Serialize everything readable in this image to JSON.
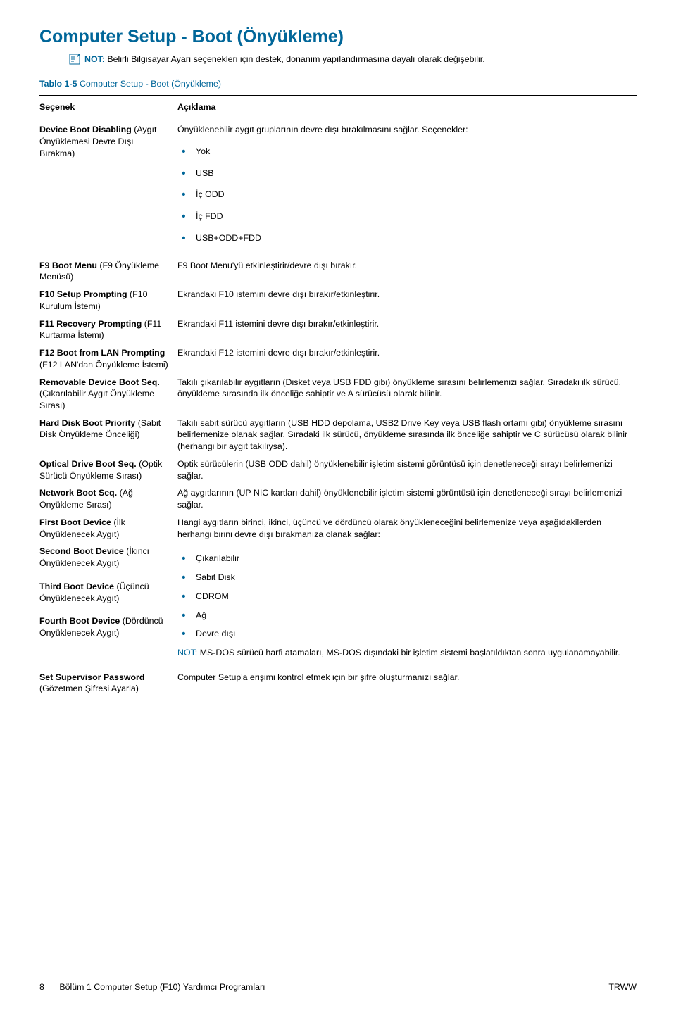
{
  "title": "Computer Setup - Boot (Önyükleme)",
  "note": {
    "label": "NOT:",
    "text": "Belirli Bilgisayar Ayarı seçenekleri için destek, donanım yapılandırmasına dayalı olarak değişebilir."
  },
  "caption": {
    "lbl": "Tablo 1-5",
    "txt": "Computer Setup - Boot (Önyükleme)"
  },
  "head": {
    "c1": "Seçenek",
    "c2": "Açıklama"
  },
  "rows": {
    "deviceBootDisabling": {
      "name_b": "Device Boot Disabling",
      "name_r": " (Aygıt Önyüklemesi Devre Dışı Bırakma)",
      "desc_lead": "Önyüklenebilir aygıt gruplarının devre dışı bırakılmasını sağlar. Seçenekler:",
      "opts": [
        "Yok",
        "USB",
        "İç ODD",
        "İç FDD",
        "USB+ODD+FDD"
      ]
    },
    "f9": {
      "name_b": "F9 Boot Menu",
      "name_r": " (F9 Önyükleme Menüsü)",
      "desc": "F9 Boot Menu'yü etkinleştirir/devre dışı bırakır."
    },
    "f10": {
      "name_b": "F10 Setup Prompting",
      "name_r": " (F10 Kurulum İstemi)",
      "desc": "Ekrandaki F10 istemini devre dışı bırakır/etkinleştirir."
    },
    "f11": {
      "name_b": "F11 Recovery Prompting",
      "name_r": " (F11 Kurtarma İstemi)",
      "desc": "Ekrandaki F11 istemini devre dışı bırakır/etkinleştirir."
    },
    "f12": {
      "name_b": "F12 Boot from LAN Prompting",
      "name_r": " (F12 LAN'dan Önyükleme İstemi)",
      "desc": "Ekrandaki F12 istemini devre dışı bırakır/etkinleştirir."
    },
    "removable": {
      "name_b": "Removable Device Boot Seq.",
      "name_r": " (Çıkarılabilir Aygıt Önyükleme Sırası)",
      "desc": "Takılı çıkarılabilir aygıtların (Disket veya USB FDD gibi) önyükleme sırasını belirlemenizi sağlar. Sıradaki ilk sürücü, önyükleme sırasında ilk önceliğe sahiptir ve A sürücüsü olarak bilinir."
    },
    "hdd": {
      "name_b": "Hard Disk Boot Priority",
      "name_r": " (Sabit Disk Önyükleme Önceliği)",
      "desc": "Takılı sabit sürücü aygıtların (USB HDD depolama, USB2 Drive Key veya USB flash ortamı gibi) önyükleme sırasını belirlemenize olanak sağlar. Sıradaki ilk sürücü, önyükleme sırasında ilk önceliğe sahiptir ve C sürücüsü olarak bilinir (herhangi bir aygıt takılıysa)."
    },
    "optical": {
      "name_b": "Optical Drive Boot Seq.",
      "name_r": " (Optik Sürücü Önyükleme Sırası)",
      "desc": "Optik sürücülerin (USB ODD dahil) önyüklenebilir işletim sistemi görüntüsü için denetleneceği sırayı belirlemenizi sağlar."
    },
    "network": {
      "name_b": "Network Boot Seq.",
      "name_r": " (Ağ Önyükleme Sırası)",
      "desc": "Ağ aygıtlarının (UP NIC kartları dahil) önyüklenebilir işletim sistemi görüntüsü için denetleneceği sırayı belirlemenizi sağlar."
    },
    "first": {
      "name_b": "First Boot Device",
      "name_r": " (İlk Önyüklenecek Aygıt)",
      "desc": "Hangi aygıtların birinci, ikinci, üçüncü ve dördüncü olarak önyükleneceğini belirlemenize veya aşağıdakilerden herhangi birini devre dışı bırakmanıza olanak sağlar:"
    },
    "second": {
      "name_b": "Second Boot Device",
      "name_r": " (İkinci Önyüklenecek Aygıt)"
    },
    "third": {
      "name_b": "Third Boot Device",
      "name_r": " (Üçüncü Önyüklenecek Aygıt)"
    },
    "fourth": {
      "name_b": "Fourth Boot Device",
      "name_r": " (Dördüncü Önyüklenecek Aygıt)"
    },
    "bootOpts": [
      "Çıkarılabilir",
      "Sabit Disk",
      "CDROM",
      "Ağ",
      "Devre dışı"
    ],
    "bootNote": {
      "lbl": "NOT:",
      "txt": "MS-DOS sürücü harfi atamaları, MS-DOS dışındaki bir işletim sistemi başlatıldıktan sonra uygulanamayabilir."
    },
    "supervisor": {
      "name_b": "Set Supervisor Password",
      "name_r": " (Gözetmen Şifresi Ayarla)",
      "desc": "Computer Setup'a erişimi kontrol etmek için bir şifre oluşturmanızı sağlar."
    }
  },
  "footer": {
    "page": "8",
    "chapter": "Bölüm 1   Computer Setup (F10) Yardımcı Programları",
    "right": "TRWW"
  }
}
